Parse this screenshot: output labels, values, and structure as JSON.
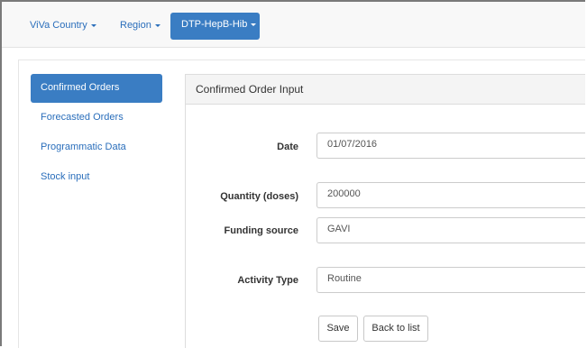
{
  "navbar": {
    "country": "ViVa Country",
    "region": "Region",
    "product": "DTP-HepB-Hib"
  },
  "sidebar": {
    "items": [
      {
        "label": "Confirmed Orders"
      },
      {
        "label": "Forecasted Orders"
      },
      {
        "label": "Programmatic Data"
      },
      {
        "label": "Stock input"
      }
    ]
  },
  "panel": {
    "title": "Confirmed Order Input",
    "fields": {
      "date": {
        "label": "Date",
        "value": "01/07/2016"
      },
      "quantity": {
        "label": "Quantity (doses)",
        "value": "200000"
      },
      "funding": {
        "label": "Funding source",
        "value": "GAVI"
      },
      "activity": {
        "label": "Activity Type",
        "value": "Routine"
      }
    },
    "buttons": {
      "save": "Save",
      "back": "Back to list"
    }
  }
}
